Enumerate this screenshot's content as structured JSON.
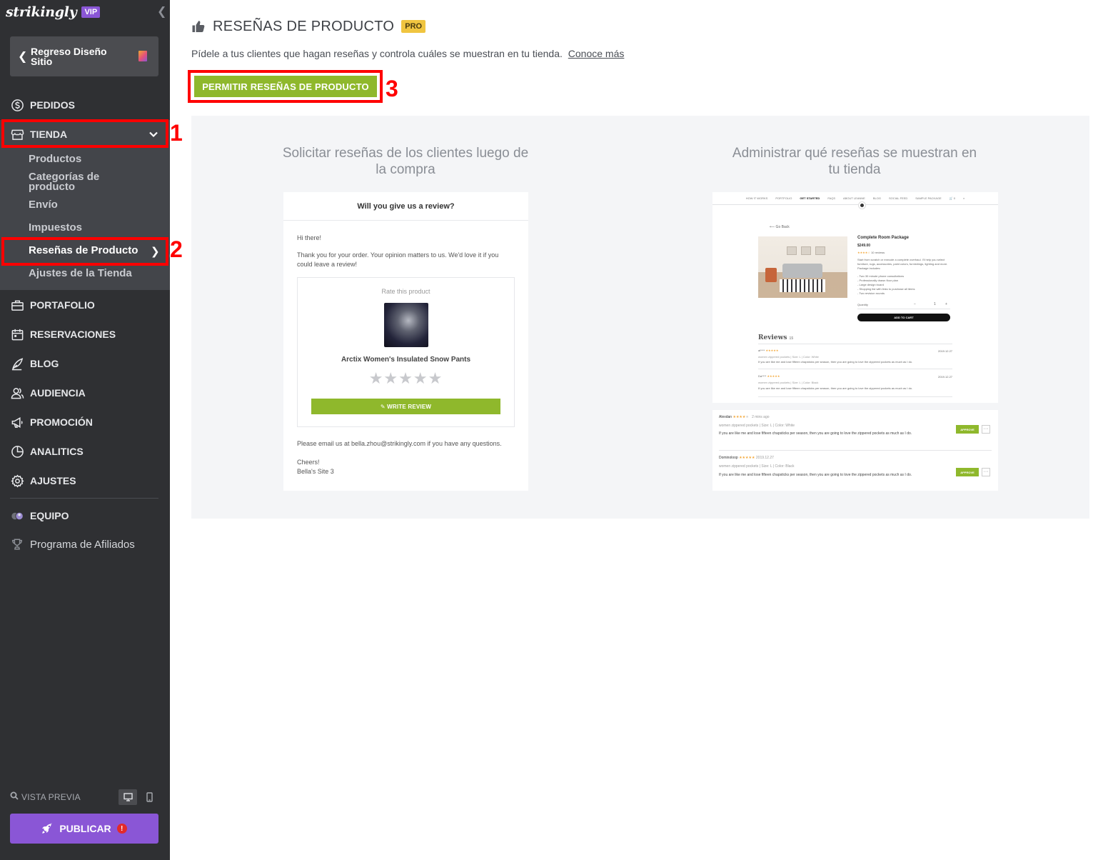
{
  "app": {
    "logo": "strikingly",
    "tier_badge": "VIP"
  },
  "sidebar": {
    "back_button": "Regreso Diseño Sitio",
    "nav_top": [
      {
        "label": "PEDIDOS",
        "icon": "dollar-circle-icon"
      },
      {
        "label": "TIENDA",
        "icon": "store-icon"
      }
    ],
    "store_subitems": [
      "Productos",
      "Categorías de producto",
      "Envío",
      "Impuestos",
      "Reseñas de Producto",
      "Ajustes de la Tienda"
    ],
    "nav_bottom": [
      {
        "label": "PORTAFOLIO",
        "icon": "briefcase-icon"
      },
      {
        "label": "RESERVACIONES",
        "icon": "calendar-icon"
      },
      {
        "label": "BLOG",
        "icon": "quill-icon"
      },
      {
        "label": "AUDIENCIA",
        "icon": "users-icon"
      },
      {
        "label": "PROMOCIÓN",
        "icon": "megaphone-icon"
      },
      {
        "label": "ANALITICS",
        "icon": "pie-chart-icon"
      },
      {
        "label": "AJUSTES",
        "icon": "gear-icon"
      }
    ],
    "team": {
      "label": "EQUIPO",
      "icon": "team-avatars-icon"
    },
    "affiliate": {
      "label": "Programa de Afiliados",
      "icon": "trophy-icon"
    },
    "preview_label": "VISTA PREVIA",
    "publish_label": "PUBLICAR",
    "publish_alert": "!"
  },
  "annotations": {
    "one": "1",
    "two": "2",
    "three": "3"
  },
  "main": {
    "title": "RESEÑAS DE PRODUCTO",
    "pro_badge": "PRO",
    "subtitle": "Pídele a tus clientes que hagan reseñas y controla cuáles se muestran en tu tienda.",
    "learn_more": "Conoce más",
    "enable_button": "PERMITIR RESEÑAS DE PRODUCTO",
    "left_column_title": "Solicitar reseñas de los clientes luego de la compra",
    "right_column_title": "Administrar qué reseñas se muestran en tu tienda"
  },
  "email_mock": {
    "header": "Will you give us a review?",
    "greeting": "Hi there!",
    "body": "Thank you for your order. Your opinion matters to us. We'd love it if you could leave a review!",
    "rate_label": "Rate this product",
    "product_name": "Arctix Women's Insulated Snow Pants",
    "stars": "★★★★★",
    "write_button": "✎ WRITE REVIEW",
    "footer": "Please email us at bella.zhou@strikingly.com if you have any questions.",
    "signoff": "Cheers!",
    "site_name": "Bella's Site 3"
  },
  "store_mock": {
    "nav": [
      "HOW IT WORKS",
      "PORTFOLIO",
      "GET STARTED",
      "FAQS",
      "ABOUT LEANNE",
      "BLOG",
      "SOCIAL FEED",
      "SAMPLE PACKAGE",
      "🛒 0",
      "⌕"
    ],
    "back_link": "⟵ Go Back",
    "product_title": "Complete Room Package",
    "price": "$249.00",
    "rating_count": "10 reviews",
    "description": "Start from scratch or execute a complete overhaul. I'll help you select furniture, rugs, accessories, paint colors, furnishings, lighting and more. Package includes:",
    "bullets": [
      "- Two 30 minute phone consultations",
      "- Professionally drawn floor plan",
      "- Large design board",
      "- Shopping list with links to purchase all items",
      "- Two revision rounds"
    ],
    "quantity_label": "Quantity",
    "quantity_value": "1",
    "add_to_cart": "ADD TO CART",
    "reviews_title": "Reviews",
    "reviews_count": "15",
    "reviews": [
      {
        "author": "al****",
        "date": "2019.12.27",
        "meta": "women zippered pockets  |  Size: L  |  Color: White",
        "text": "If you are like me and lose fifteen chapsticks per season, then you are going to love the zippered pockets as much as I do."
      },
      {
        "author": "Da****",
        "date": "2019.12.27",
        "meta": "women zippered pockets  |  Size: L  |  Color: Black",
        "text": "If you are like me and lose fifteen chapsticks per season, then you are going to love the zippered pockets as much as I do."
      }
    ]
  },
  "admin_mock": {
    "approve_label": "APPROVE",
    "more_label": "···",
    "rows": [
      {
        "author": "Alexdan",
        "date": "2 mins ago",
        "meta": "women zippered pockets  |  Size: L  |  Color: White",
        "text": "If you are like me and lose fifteen chapsticks per season, then you are going to love the zippered pockets as much as I do."
      },
      {
        "author": "Dominoloop",
        "date": "2019.12.27",
        "meta": "women zippered pockets  |  Size: L  |  Color: Black",
        "text": "If you are like me and lose fifteen chapsticks per season, then you are going to love the zippered pockets as much as I do."
      }
    ]
  },
  "colors": {
    "sidebar_bg": "#2f3033",
    "sidebar_sub_bg": "#43454a",
    "brand_purple": "#8a56d6",
    "accent_green": "#8fb82c",
    "pro_yellow": "#f0c540",
    "annotation_red": "#ff0000"
  }
}
